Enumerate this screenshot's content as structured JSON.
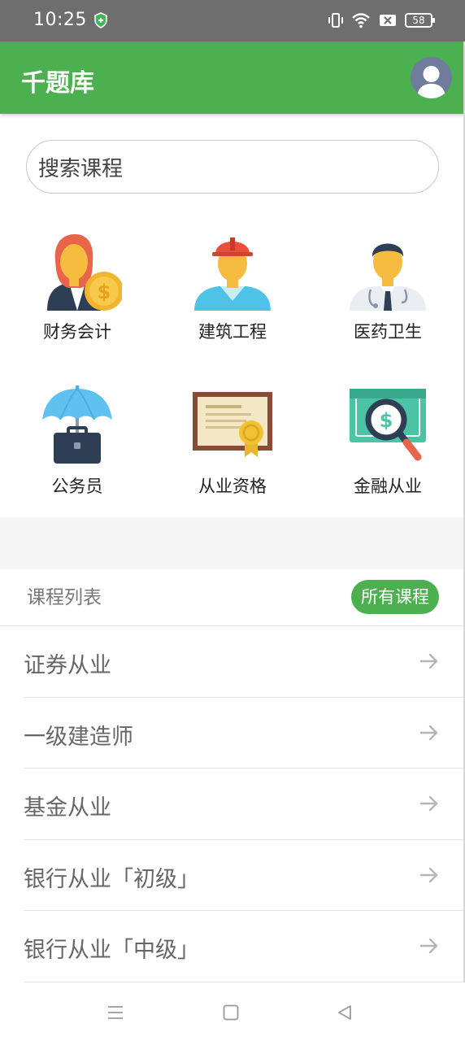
{
  "status_bar": {
    "time": "10:25",
    "battery": "58"
  },
  "app_bar": {
    "title": "千题库"
  },
  "search": {
    "placeholder": "搜索课程"
  },
  "categories": [
    {
      "label": "财务会计",
      "icon": "accountant-icon"
    },
    {
      "label": "建筑工程",
      "icon": "construction-worker-icon"
    },
    {
      "label": "医药卫生",
      "icon": "doctor-icon"
    },
    {
      "label": "公务员",
      "icon": "umbrella-briefcase-icon"
    },
    {
      "label": "从业资格",
      "icon": "certificate-icon"
    },
    {
      "label": "金融从业",
      "icon": "money-search-icon"
    }
  ],
  "course_list": {
    "title": "课程列表",
    "all_button": "所有课程",
    "items": [
      {
        "label": "证券从业"
      },
      {
        "label": "一级建造师"
      },
      {
        "label": "基金从业"
      },
      {
        "label": "银行从业「初级」"
      },
      {
        "label": "银行从业「中级」"
      }
    ]
  },
  "colors": {
    "primary": "#4caf50",
    "status_bar": "#6e6e6e"
  }
}
